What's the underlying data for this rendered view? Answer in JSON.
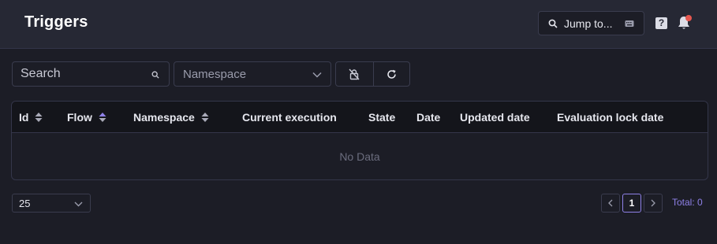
{
  "header": {
    "title": "Triggers",
    "jump_label": "Jump to..."
  },
  "filters": {
    "search_placeholder": "Search",
    "namespace_placeholder": "Namespace"
  },
  "table": {
    "columns": [
      "Id",
      "Flow",
      "Namespace",
      "Current execution",
      "State",
      "Date",
      "Updated date",
      "Evaluation lock date"
    ],
    "empty_text": "No Data"
  },
  "pagination": {
    "per_page": "25",
    "current_page": "1",
    "total_label": "Total: 0"
  },
  "colors": {
    "accent": "#8f81e8",
    "notification": "#e5574f",
    "background": "#1c1d26"
  },
  "icons": {
    "search": "search-icon",
    "keyboard": "keyboard-icon",
    "help": "help-icon",
    "bell": "bell-icon",
    "chevron": "chevron-down-icon",
    "unlock": "unlock-icon",
    "refresh": "refresh-icon",
    "sort": "sort-icon"
  }
}
